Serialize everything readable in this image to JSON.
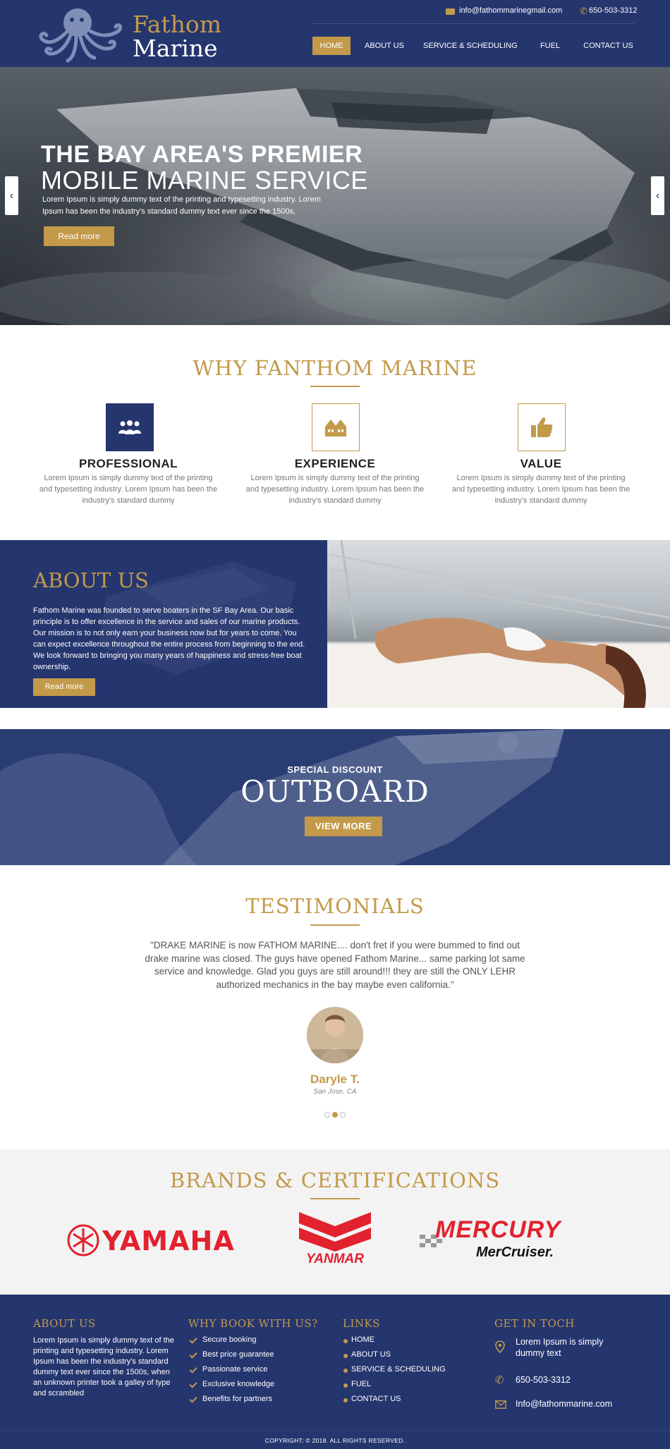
{
  "header": {
    "logo": {
      "line1": "Fathom",
      "line2": "Marine"
    },
    "contact": {
      "email": "info@fathommarinegmail.com",
      "phone": "650-503-3312"
    },
    "nav": [
      {
        "label": "HOME",
        "active": true
      },
      {
        "label": "ABOUT US",
        "active": false
      },
      {
        "label": "SERVICE & SCHEDULING",
        "active": false
      },
      {
        "label": "FUEL",
        "active": false
      },
      {
        "label": "CONTACT US",
        "active": false
      }
    ]
  },
  "hero": {
    "title_line1": "THE BAY AREA'S PREMIER",
    "title_line2": "MOBILE MARINE SERVICE",
    "text": "Lorem Ipsum is simply dummy text of the printing and typesetting industry. Lorem Ipsum has been the industry's standard dummy text ever since the 1500s,",
    "button": "Read more",
    "prev_arrow": "‹",
    "next_arrow": "‹"
  },
  "why": {
    "title": "WHY FANTHOM MARINE",
    "features": [
      {
        "icon": "group-icon",
        "title": "PROFESSIONAL",
        "text": "Lorem Ipsum is simply dummy text of the printing and typesetting industry. Lorem Ipsum has been the industry's standard dummy"
      },
      {
        "icon": "houses-icon",
        "title": "EXPERIENCE",
        "text": "Lorem Ipsum is simply dummy text of the printing and typesetting industry. Lorem Ipsum has been the industry's standard dummy"
      },
      {
        "icon": "thumbs-up-icon",
        "title": "VALUE",
        "text": "Lorem Ipsum is simply dummy text of the printing and typesetting industry. Lorem Ipsum has been the industry's standard dummy"
      }
    ]
  },
  "about": {
    "title": "ABOUT US",
    "text": "Fathom Marine was founded to serve boaters in the SF Bay Area. Our basic principle is to offer excellence in the service and sales of our marine products. Our mission is to not only earn your business now but for years to come. You can expect excellence throughout the entire process from beginning to the end. We look forward to bringing you many years of happiness and stress-free boat ownership.",
    "button": "Read more"
  },
  "outboard": {
    "subtitle": "SPECIAL DISCOUNT",
    "title": "OUTBOARD",
    "button": "VIEW MORE"
  },
  "testimonials": {
    "title": "TESTIMONIALS",
    "quote": "\"DRAKE MARINE is now FATHOM MARINE.... don't fret if you were bummed to find out drake marine was closed.  The guys have opened Fathom Marine... same parking lot same service and knowledge.  Glad you guys are still around!!! they are still the ONLY LEHR authorized mechanics in the bay maybe even california.\"",
    "name": "Daryle T.",
    "location": "San Jose, CA",
    "active_dot": 1
  },
  "brands": {
    "title": "BRANDS & CERTIFICATIONS",
    "logos": [
      {
        "name": "YAMAHA"
      },
      {
        "name": "YANMAR"
      },
      {
        "name": "MERCURY",
        "sub": "MerCruiser."
      }
    ]
  },
  "footer": {
    "about": {
      "title": "ABOUT US",
      "text": "Lorem Ipsum is simply dummy text of the printing and typesetting industry. Lorem Ipsum has been the industry's standard dummy text ever since the 1500s, when an unknown printer took a galley of type and scrambled"
    },
    "why": {
      "title": "WHY BOOK WITH US?",
      "items": [
        "Secure booking",
        "Best price guarantee",
        "Passionate service",
        "Exclusive knowledge",
        "Benefits for partners"
      ]
    },
    "links": {
      "title": "LINKS",
      "items": [
        "HOME",
        "ABOUT US",
        "SERVICE & SCHEDULING",
        "FUEL",
        "CONTACT US"
      ]
    },
    "contact": {
      "title": "GET IN TOCH",
      "address": "Lorem Ipsum is simply dummy text",
      "phone": "650-503-3312",
      "email": "Info@fathommarine.com"
    },
    "copyright": "COPYRIGHT: © 2018. ALL RIGHTS RESERVED."
  },
  "colors": {
    "navy": "#25366f",
    "gold": "#c39a4a",
    "red": "#e2222f"
  }
}
